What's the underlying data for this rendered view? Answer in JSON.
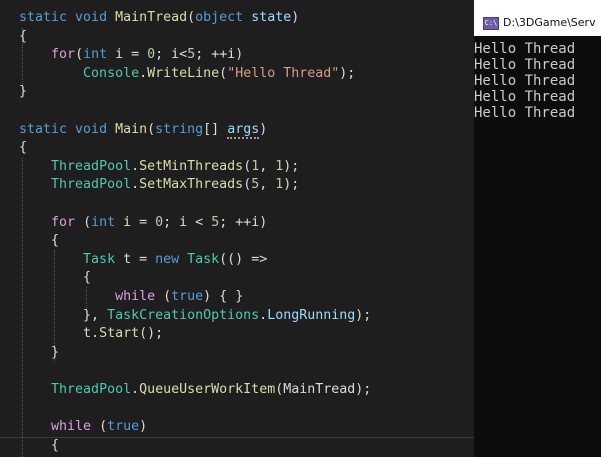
{
  "editor": {
    "lines": [
      {
        "t": [
          [
            "kw",
            "static "
          ],
          [
            "kw",
            "void "
          ],
          [
            "mt",
            "MainTread"
          ],
          [
            "pl",
            "("
          ],
          [
            "kw",
            "object "
          ],
          [
            "pm",
            "state"
          ],
          [
            "pl",
            ")"
          ]
        ]
      },
      {
        "t": [
          [
            "pl",
            "{"
          ]
        ]
      },
      {
        "t": [
          [
            "pl",
            "    "
          ],
          [
            "ctl",
            "for"
          ],
          [
            "pl",
            "("
          ],
          [
            "kw",
            "int "
          ],
          [
            "pl",
            "i = "
          ],
          [
            "nm",
            "0"
          ],
          [
            "pl",
            "; i<"
          ],
          [
            "nm",
            "5"
          ],
          [
            "pl",
            "; ++i)"
          ]
        ]
      },
      {
        "t": [
          [
            "pl",
            "        "
          ],
          [
            "ty",
            "Console"
          ],
          [
            "pl",
            "."
          ],
          [
            "mt",
            "WriteLine"
          ],
          [
            "pl",
            "("
          ],
          [
            "st",
            "\"Hello Thread\""
          ],
          [
            "pl",
            ");"
          ]
        ]
      },
      {
        "t": [
          [
            "pl",
            "}"
          ]
        ]
      },
      {
        "t": []
      },
      {
        "t": [
          [
            "kw",
            "static "
          ],
          [
            "kw",
            "void "
          ],
          [
            "mt",
            "Main"
          ],
          [
            "pl",
            "("
          ],
          [
            "kw",
            "string"
          ],
          [
            "pl",
            "[] "
          ],
          [
            "pmsq",
            "args"
          ],
          [
            "pl",
            ")"
          ]
        ]
      },
      {
        "t": [
          [
            "pl",
            "{"
          ]
        ]
      },
      {
        "t": [
          [
            "pl",
            "    "
          ],
          [
            "ty",
            "ThreadPool"
          ],
          [
            "pl",
            "."
          ],
          [
            "mt",
            "SetMinThreads"
          ],
          [
            "pl",
            "("
          ],
          [
            "nm",
            "1"
          ],
          [
            "pl",
            ", "
          ],
          [
            "nm",
            "1"
          ],
          [
            "pl",
            ");"
          ]
        ]
      },
      {
        "t": [
          [
            "pl",
            "    "
          ],
          [
            "ty",
            "ThreadPool"
          ],
          [
            "pl",
            "."
          ],
          [
            "mt",
            "SetMaxThreads"
          ],
          [
            "pl",
            "("
          ],
          [
            "nm",
            "5"
          ],
          [
            "pl",
            ", "
          ],
          [
            "nm",
            "1"
          ],
          [
            "pl",
            ");"
          ]
        ]
      },
      {
        "t": []
      },
      {
        "t": [
          [
            "pl",
            "    "
          ],
          [
            "ctl",
            "for "
          ],
          [
            "pl",
            "("
          ],
          [
            "kw",
            "int "
          ],
          [
            "pl",
            "i = "
          ],
          [
            "nm",
            "0"
          ],
          [
            "pl",
            "; i < "
          ],
          [
            "nm",
            "5"
          ],
          [
            "pl",
            "; ++i)"
          ]
        ]
      },
      {
        "t": [
          [
            "pl",
            "    {"
          ]
        ]
      },
      {
        "t": [
          [
            "pl",
            "        "
          ],
          [
            "ty",
            "Task "
          ],
          [
            "pl",
            "t = "
          ],
          [
            "kw",
            "new "
          ],
          [
            "ty",
            "Task"
          ],
          [
            "pl",
            "(() =>"
          ]
        ]
      },
      {
        "t": [
          [
            "pl",
            "        {"
          ]
        ]
      },
      {
        "t": [
          [
            "pl",
            "            "
          ],
          [
            "ctl",
            "while "
          ],
          [
            "pl",
            "("
          ],
          [
            "kw",
            "true"
          ],
          [
            "pl",
            ") { }"
          ]
        ]
      },
      {
        "t": [
          [
            "pl",
            "        }, "
          ],
          [
            "ty",
            "TaskCreationOptions"
          ],
          [
            "pl",
            "."
          ],
          [
            "pm",
            "LongRunning"
          ],
          [
            "pl",
            ");"
          ]
        ]
      },
      {
        "t": [
          [
            "pl",
            "        t."
          ],
          [
            "mt",
            "Start"
          ],
          [
            "pl",
            "();"
          ]
        ]
      },
      {
        "t": [
          [
            "pl",
            "    }"
          ]
        ]
      },
      {
        "t": []
      },
      {
        "t": [
          [
            "pl",
            "    "
          ],
          [
            "ty",
            "ThreadPool"
          ],
          [
            "pl",
            "."
          ],
          [
            "mt",
            "QueueUserWorkItem"
          ],
          [
            "pl",
            "(MainTread);"
          ]
        ]
      },
      {
        "t": []
      },
      {
        "t": [
          [
            "pl",
            "    "
          ],
          [
            "ctl",
            "while "
          ],
          [
            "pl",
            "("
          ],
          [
            "kw",
            "true"
          ],
          [
            "pl",
            ")"
          ]
        ]
      },
      {
        "t": [
          [
            "pl",
            "    {"
          ]
        ]
      }
    ]
  },
  "console": {
    "title": "D:\\3DGame\\Serv",
    "icon_label": "C:\\",
    "output": [
      "Hello Thread",
      "Hello Thread",
      "Hello Thread",
      "Hello Thread",
      "Hello Thread"
    ]
  },
  "colors": {
    "keyword": "#569cd6",
    "control": "#d8a0df",
    "type": "#4ec9b0",
    "method": "#dcdcaa",
    "string": "#d69d85",
    "number": "#b5cea8",
    "parameter": "#9cdcfe",
    "editor_bg": "#1e1e1e",
    "console_bg": "#0c0c0c"
  }
}
